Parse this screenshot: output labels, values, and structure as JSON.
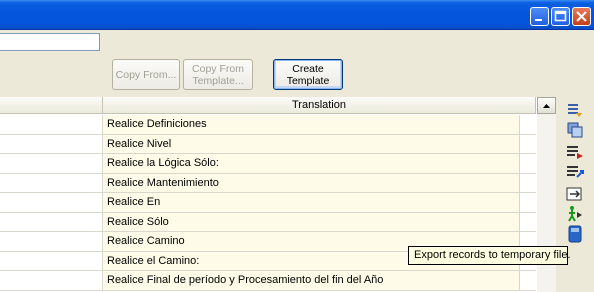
{
  "window": {
    "controls": [
      "minimize-icon",
      "maximize-icon",
      "close-icon"
    ]
  },
  "toolbar": {
    "field_value": "",
    "copy_from_label": "Copy From...",
    "copy_from_template_label": "Copy From\nTemplate...",
    "create_template_label": "Create\nTemplate"
  },
  "grid": {
    "columns": [
      "",
      "Translation"
    ],
    "rows": [
      {
        "translation": "Realice Definiciones"
      },
      {
        "translation": "Realice Nivel"
      },
      {
        "translation": "Realice la Lógica Sólo:"
      },
      {
        "translation": "Realice Mantenimiento"
      },
      {
        "translation": "Realice En"
      },
      {
        "translation": "Realice Sólo"
      },
      {
        "translation": "Realice Camino"
      },
      {
        "translation": "Realice el Camino:"
      },
      {
        "translation": "Realice Final de período y Procesamiento del fin del Año"
      }
    ]
  },
  "side_toolbar": {
    "icons": [
      "export-list-icon",
      "copy-records-icon",
      "delete-row-icon",
      "insert-row-icon",
      "link-records-icon",
      "run-person-icon",
      "export-file-icon"
    ]
  },
  "tooltip": {
    "text": "Export records to temporary file."
  }
}
